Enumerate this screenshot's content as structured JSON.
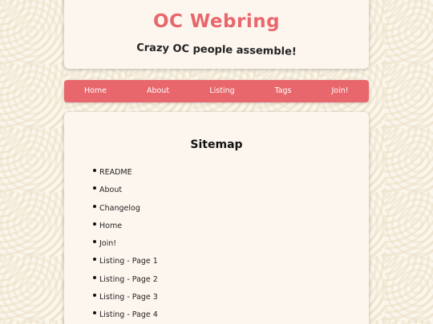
{
  "header": {
    "title": "OC Webring",
    "tagline": "Crazy OC people assemble!"
  },
  "nav": {
    "items": [
      "Home",
      "About",
      "Listing",
      "Tags",
      "Join!"
    ]
  },
  "main": {
    "section_title": "Sitemap",
    "links": [
      "README",
      "About",
      "Changelog",
      "Home",
      "Join!",
      "Listing - Page 1",
      "Listing - Page 2",
      "Listing - Page 3",
      "Listing - Page 4"
    ]
  },
  "colors": {
    "accent": "#e8676c",
    "card": "#fdf6ef",
    "background": "#fbf6ec"
  }
}
